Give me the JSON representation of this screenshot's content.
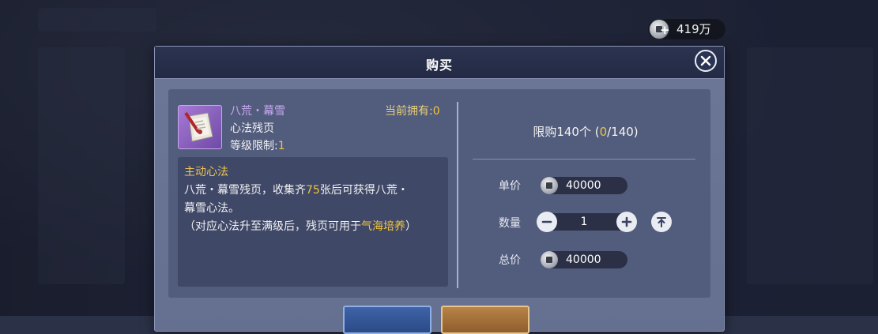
{
  "currency": {
    "icon": "silver-coin-icon",
    "add_icon": "plus-icon",
    "value": "419万"
  },
  "dialog": {
    "title": "购买",
    "item": {
      "name": "八荒・幕雪",
      "type": "心法残页",
      "level_label": "等级限制:",
      "level_value": "1",
      "owned_label": "当前拥有:",
      "owned_value": "0",
      "icon": "scroll-page-icon"
    },
    "description": {
      "heading": "主动心法",
      "line1_a": "八荒・幕雪残页，收集齐",
      "line1_num": "75",
      "line1_b": "张后可获得八荒・",
      "line2": "幕雪心法。",
      "line3_a": "（对应心法升至满级后，残页可用于",
      "line3_hl": "气海培养",
      "line3_b": "）"
    },
    "purchase": {
      "limit_text_a": "限购140个 (",
      "limit_current": "0",
      "limit_text_b": "/140)",
      "unit_price_label": "单价",
      "unit_price": "40000",
      "quantity_label": "数量",
      "quantity": "1",
      "total_label": "总价",
      "total": "40000"
    },
    "buttons": {
      "cancel": "",
      "buy": ""
    }
  },
  "colors": {
    "accent_gold": "#f0c542",
    "item_purple": "#c8a8f0",
    "cancel_blue": "#2b4a86",
    "buy_bronze": "#8f5d2c"
  }
}
